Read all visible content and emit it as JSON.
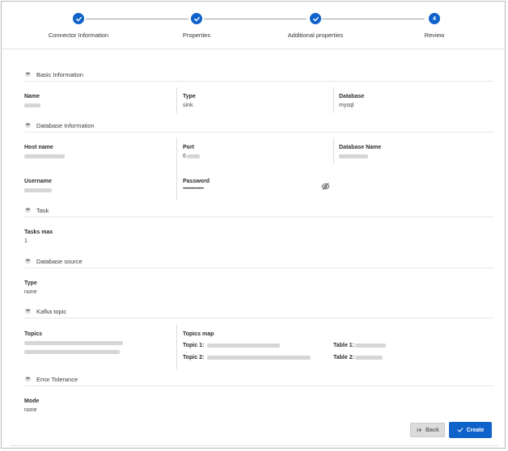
{
  "stepper": {
    "steps": [
      {
        "label": "Connector Information",
        "state": "done"
      },
      {
        "label": "Properties",
        "state": "done"
      },
      {
        "label": "Additional properties",
        "state": "done"
      },
      {
        "label": "Review",
        "state": "current",
        "number": "4"
      }
    ]
  },
  "sections": {
    "basic": {
      "title": "Basic Information",
      "name_label": "Name",
      "type_label": "Type",
      "type_value": "sink",
      "database_label": "Database",
      "database_value": "mysql"
    },
    "database_info": {
      "title": "Database Information",
      "host_label": "Host name",
      "port_label": "Port",
      "port_value_prefix": "6",
      "db_name_label": "Database Name",
      "username_label": "Username",
      "password_label": "Password",
      "password_value": "••••••••••••••••"
    },
    "task": {
      "title": "Task",
      "tasks_max_label": "Tasks max",
      "tasks_max_value": "1"
    },
    "database_source": {
      "title": "Database source",
      "type_label": "Type",
      "type_value": "none"
    },
    "kafka_topic": {
      "title": "Kafka topic",
      "topics_label": "Topics",
      "topics_map_label": "Topics map",
      "topic1_label": "Topic 1:",
      "topic2_label": "Topic 2:",
      "table1_label": "Table 1:",
      "table2_label": "Table 2:"
    },
    "error_tolerance": {
      "title": "Error Tolerance",
      "mode_label": "Mode",
      "mode_value": "none"
    }
  },
  "footer": {
    "back_label": "Back",
    "create_label": "Create"
  },
  "colors": {
    "accent": "#0f62c9",
    "border": "#b9b9b9"
  },
  "icons": {
    "section": "layers-icon",
    "step_done": "check-icon",
    "password_toggle": "eye-off-icon",
    "back": "first-page-icon",
    "create": "check-icon"
  }
}
